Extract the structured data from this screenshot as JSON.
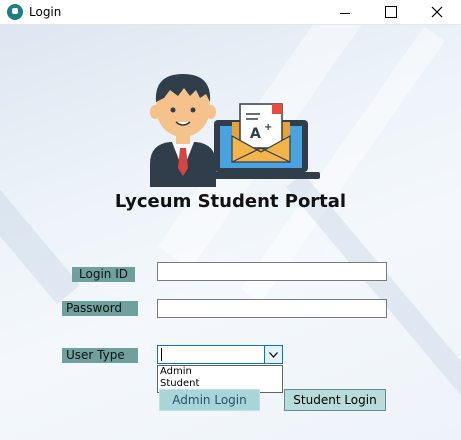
{
  "window": {
    "title": "Login",
    "controls": {
      "minimize": "—",
      "maximize": "☐",
      "close": "✕"
    }
  },
  "app": {
    "title": "Lyceum Student Portal"
  },
  "form": {
    "login_id_label": "Login ID",
    "password_label": "Password",
    "user_type_label": "User Type",
    "login_id_value": "",
    "password_value": "",
    "user_type_value": "",
    "user_type_options": [
      "Admin",
      "Student"
    ]
  },
  "buttons": {
    "admin_login": "Admin Login",
    "student_login": "Student Login"
  },
  "icons": {
    "app": "app-icon",
    "logo": "student-mail-illustration"
  },
  "colors": {
    "label_bg": "#6fa0a0",
    "button_bg": "#b8dcdc",
    "accent": "#0078d7"
  }
}
